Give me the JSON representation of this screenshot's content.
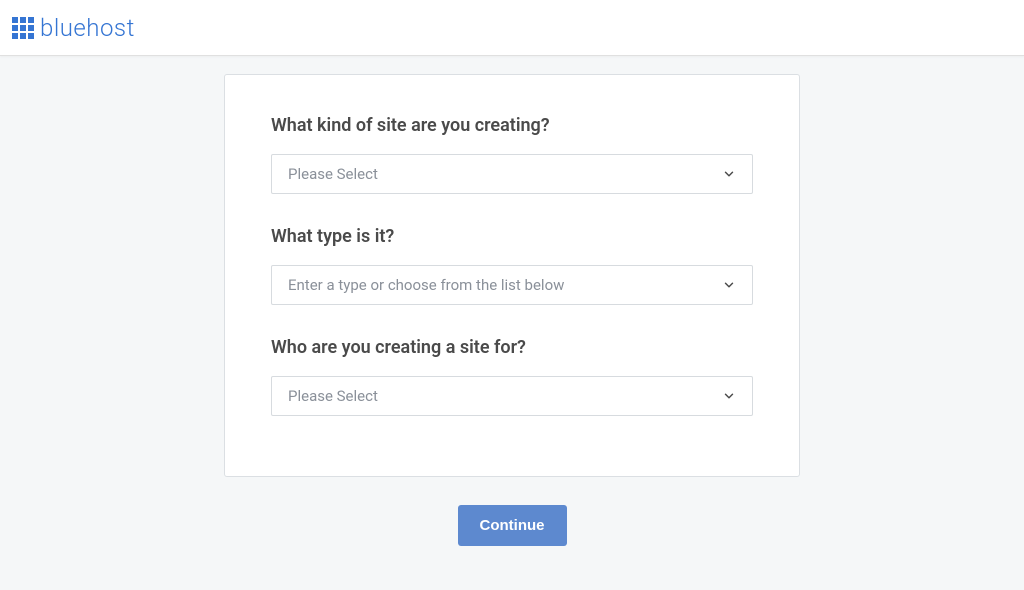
{
  "header": {
    "brand": "bluehost"
  },
  "form": {
    "q1": {
      "label": "What kind of site are you creating?",
      "placeholder": "Please Select"
    },
    "q2": {
      "label": "What type is it?",
      "placeholder": "Enter a type or choose from the list below"
    },
    "q3": {
      "label": "Who are you creating a site for?",
      "placeholder": "Please Select"
    }
  },
  "actions": {
    "continue": "Continue"
  },
  "colors": {
    "brand": "#3575d3",
    "button": "#5d89cf"
  }
}
